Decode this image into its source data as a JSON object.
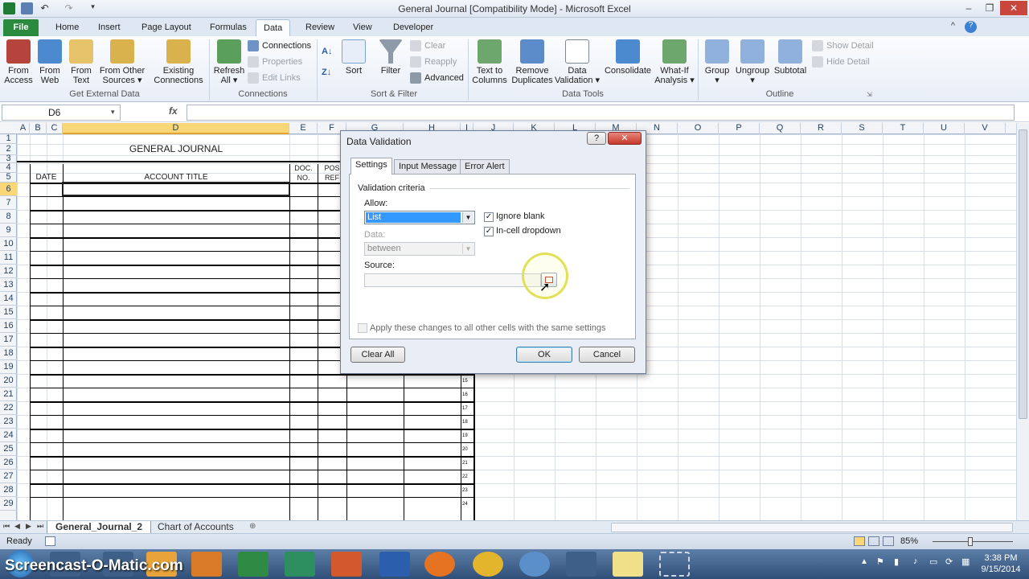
{
  "window": {
    "title": "General Journal  [Compatibility Mode]  -  Microsoft Excel"
  },
  "tabs": [
    "File",
    "Home",
    "Insert",
    "Page Layout",
    "Formulas",
    "Data",
    "Review",
    "View",
    "Developer"
  ],
  "ribbon": {
    "get_external": {
      "from_access_1": "From",
      "from_access_2": "Access",
      "from_web_1": "From",
      "from_web_2": "Web",
      "from_text_1": "From",
      "from_text_2": "Text",
      "from_other_1": "From Other",
      "from_other_2": "Sources ▾",
      "existing_1": "Existing",
      "existing_2": "Connections",
      "label": "Get External Data"
    },
    "connections": {
      "refresh_1": "Refresh",
      "refresh_2": "All ▾",
      "connections": "Connections",
      "properties": "Properties",
      "edit_links": "Edit Links",
      "label": "Connections"
    },
    "sort_filter": {
      "sort": "Sort",
      "filter": "Filter",
      "clear": "Clear",
      "reapply": "Reapply",
      "advanced": "Advanced",
      "label": "Sort & Filter"
    },
    "data_tools": {
      "text_to_columns_1": "Text to",
      "text_to_columns_2": "Columns",
      "remove_duplicates_1": "Remove",
      "remove_duplicates_2": "Duplicates",
      "data_validation_1": "Data",
      "data_validation_2": "Validation ▾",
      "consolidate": "Consolidate",
      "what_if_1": "What-If",
      "what_if_2": "Analysis ▾",
      "label": "Data Tools"
    },
    "outline": {
      "group_1": "Group",
      "group_2": "▾",
      "ungroup_1": "Ungroup",
      "ungroup_2": "▾",
      "subtotal": "Subtotal",
      "show_detail": "Show Detail",
      "hide_detail": "Hide Detail",
      "label": "Outline"
    }
  },
  "formula_bar": {
    "name_box": "D6",
    "fx": "fx",
    "value": ""
  },
  "sheet": {
    "columns": [
      "A",
      "B",
      "C",
      "D",
      "E",
      "F",
      "G",
      "H",
      "I",
      "J",
      "K",
      "L",
      "M",
      "N",
      "O",
      "P",
      "Q",
      "R",
      "S",
      "T",
      "U",
      "V"
    ],
    "rows": [
      "1",
      "2",
      "3",
      "4",
      "5",
      "6",
      "7",
      "8",
      "9",
      "10",
      "11",
      "12",
      "13",
      "14",
      "15",
      "16",
      "17",
      "18",
      "19",
      "20",
      "21",
      "22",
      "23",
      "24",
      "25",
      "26",
      "27",
      "28",
      "29"
    ],
    "journal_title": "GENERAL JOURNAL",
    "hdr_date": "DATE",
    "hdr_account": "ACCOUNT TITLE",
    "hdr_doc_1": "DOC.",
    "hdr_doc_2": "NO.",
    "hdr_post_1": "POS",
    "hdr_post_2": "REF",
    "side_numbers": [
      "15",
      "16",
      "17",
      "18",
      "19",
      "20",
      "21",
      "22",
      "23",
      "24"
    ]
  },
  "sheet_tabs": [
    "General_Journal_2",
    "Chart of Accounts"
  ],
  "status": {
    "ready": "Ready",
    "zoom": "85%"
  },
  "dialog": {
    "title": "Data Validation",
    "help": "?",
    "close": "✕",
    "tabs": [
      "Settings",
      "Input Message",
      "Error Alert"
    ],
    "section": "Validation criteria",
    "allow_label": "Allow:",
    "allow_value": "List",
    "ignore_blank": "Ignore blank",
    "in_cell_dropdown": "In-cell dropdown",
    "data_label": "Data:",
    "data_value": "between",
    "source_label": "Source:",
    "source_value": "",
    "apply_all": "Apply these changes to all other cells with the same settings",
    "clear_all": "Clear All",
    "ok": "OK",
    "cancel": "Cancel"
  },
  "taskbar": {
    "time": "3:38 PM",
    "date": "9/15/2014",
    "watermark": "Screencast-O-Matic.com"
  }
}
